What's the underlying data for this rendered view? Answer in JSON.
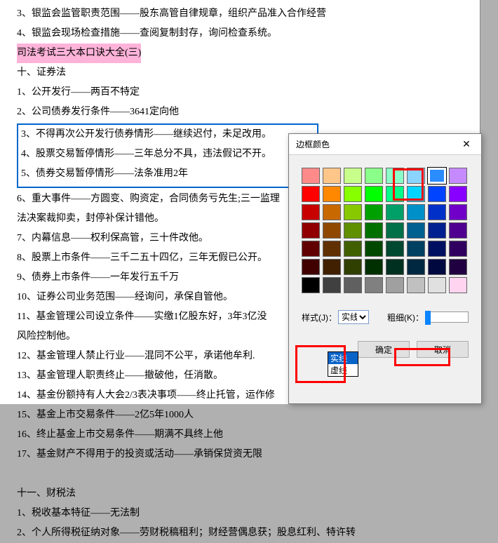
{
  "document": {
    "lines_top": [
      "3、银监会监管职责范围——股东高管自律规章，组织产品准入合作经营",
      "4、银监会现场检查措施——查阅复制封存，询问检查系统。"
    ],
    "highlighted": "司法考试三大本口诀大全(三)",
    "lines_mid": [
      "十、证券法",
      "1、公开发行——两百不特定",
      "2、公司债券发行条件——3641定向他"
    ],
    "boxed_lines": [
      "3、不得再次公开发行债券情形——继续迟付，未足改用。",
      "4、股票交易暂停情形——三年总分不具，违法假记不开。",
      "5、债券交易暂停情形——法条准用2年"
    ],
    "lines_after": [
      "6、重大事件——方圆变、购资定，合同债务亏先生;三一监理",
      "法决案裁抑卖，封停补保计错他。",
      "7、内幕信息——权利保高管，三十件改他。",
      "8、股票上市条件——三千二五十四亿，三年无假已公开。",
      "9、债券上市条件——一年发行五千万",
      "10、证券公司业务范围——经询问，承保自管他。",
      "11、基金管理公司设立条件——实缴1亿股东好，3年3亿没",
      "风险控制他。",
      "12、基金管理人禁止行业——混同不公平，承诺他牟利.",
      "13、基金管理人职责终止——撤破他，任消散。",
      "14、基金份额持有人大会2/3表决事项——终止托管，运作修",
      "15、基金上市交易条件——2亿5年1000人",
      "16、终止基金上市交易条件——期满不具终上他",
      "17、基金财产不得用于的投资或活动——承销保贷资无限",
      "",
      "十一、财税法",
      "1、税收基本特征——无法制",
      "2、个人所得税征纳对象——劳财税稿租利；财经营偶息获；股息红利、特许转"
    ]
  },
  "dialog": {
    "title": "边框颜色",
    "style_label": "样式(J)：",
    "style_options": [
      "实线",
      "虚线"
    ],
    "style_selected": "实线",
    "thick_label": "粗细(K)：",
    "ok_label": "确定",
    "cancel_label": "取消",
    "colors": [
      [
        "#ff8a8a",
        "#ffc68a",
        "#c8ff8a",
        "#8aff8a",
        "#8affc8",
        "#8ad4ff",
        "#2a8cff",
        "#c68aff",
        "#ff8aff"
      ],
      [
        "#ff0000",
        "#ff8800",
        "#88ff00",
        "#00ff00",
        "#00ff88",
        "#00d4ff",
        "#0044ff",
        "#8800ff",
        "#ff00ff"
      ],
      [
        "#c80000",
        "#c86800",
        "#88c800",
        "#00a000",
        "#00a068",
        "#0090c8",
        "#0030c8",
        "#7000c8",
        "#c800c8"
      ],
      [
        "#900000",
        "#904800",
        "#609000",
        "#007000",
        "#007048",
        "#006090",
        "#002090",
        "#500090",
        "#900090"
      ],
      [
        "#600000",
        "#603000",
        "#406000",
        "#004800",
        "#004830",
        "#004060",
        "#001060",
        "#300060",
        "#600060"
      ],
      [
        "#400000",
        "#402000",
        "#304000",
        "#003000",
        "#003020",
        "#002840",
        "#000840",
        "#200040",
        "#400040"
      ],
      [
        "#000000",
        "#404040",
        "#606060",
        "#808080",
        "#a0a0a0",
        "#c0c0c0",
        "#e0e0e0",
        "#ffd4f0",
        "#ffffff"
      ]
    ],
    "selected_row": 0,
    "selected_col": 6
  }
}
